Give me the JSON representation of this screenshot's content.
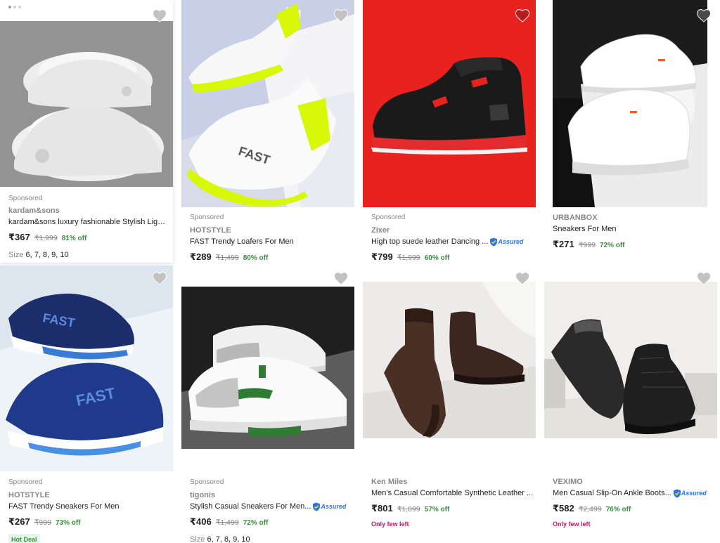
{
  "colors": {
    "price_off": "#388e3c",
    "few_left": "#d0155a",
    "assured_blue": "#2874f0",
    "heart_default": "#c2c2c2",
    "heart_active": "#d32f2f"
  },
  "products": [
    {
      "sponsored": "Sponsored",
      "brand": "kardam&sons",
      "title": "kardam&sons luxury fashionable Stylish Lightweight Sneakers",
      "price": "₹367",
      "mrp": "₹1,999",
      "off": "81% off",
      "size_label": "Size",
      "sizes": "6, 7, 8, 9, 10",
      "wishlisted": false,
      "icon": "heart-icon"
    },
    {
      "sponsored": "Sponsored",
      "brand": "HOTSTYLE",
      "title": "FAST Trendy Loafers For Men",
      "price": "₹289",
      "mrp": "₹1,499",
      "off": "80% off",
      "wishlisted": false,
      "icon": "heart-icon"
    },
    {
      "sponsored": "Sponsored",
      "brand": "Zixer",
      "title": "High top suede leather Dancing ...",
      "assured": "Assured",
      "price": "₹799",
      "mrp": "₹1,999",
      "off": "60% off",
      "wishlisted": true,
      "icon": "heart-icon"
    },
    {
      "brand": "URBANBOX",
      "title": "Sneakers For Men",
      "price": "₹271",
      "mrp": "₹999",
      "off": "72% off",
      "wishlisted": false,
      "icon": "heart-icon"
    },
    {
      "sponsored": "Sponsored",
      "brand": "HOTSTYLE",
      "title": "FAST Trendy Sneakers For Men",
      "price": "₹267",
      "mrp": "₹999",
      "off": "73% off",
      "badge": "Hot Deal",
      "wishlisted": false,
      "icon": "heart-icon"
    },
    {
      "sponsored": "Sponsored",
      "brand": "tigonis",
      "title": "Stylish Casual Sneakers For Men...",
      "assured": "Assured",
      "price": "₹406",
      "mrp": "₹1,499",
      "off": "72% off",
      "size_label": "Size",
      "sizes": "6, 7, 8, 9, 10",
      "wishlisted": false,
      "icon": "heart-icon"
    },
    {
      "brand": "Ken Miles",
      "title": "Men's Casual Comfortable Synthetic Leather ...",
      "price": "₹801",
      "mrp": "₹1,899",
      "off": "57% off",
      "stock": "Only few left",
      "wishlisted": false,
      "icon": "heart-icon"
    },
    {
      "brand": "VEXIMO",
      "title": "Men Casual Slip-On Ankle Boots...",
      "assured": "Assured",
      "price": "₹582",
      "mrp": "₹2,499",
      "off": "76% off",
      "stock": "Only few left",
      "wishlisted": false,
      "icon": "heart-icon"
    }
  ]
}
